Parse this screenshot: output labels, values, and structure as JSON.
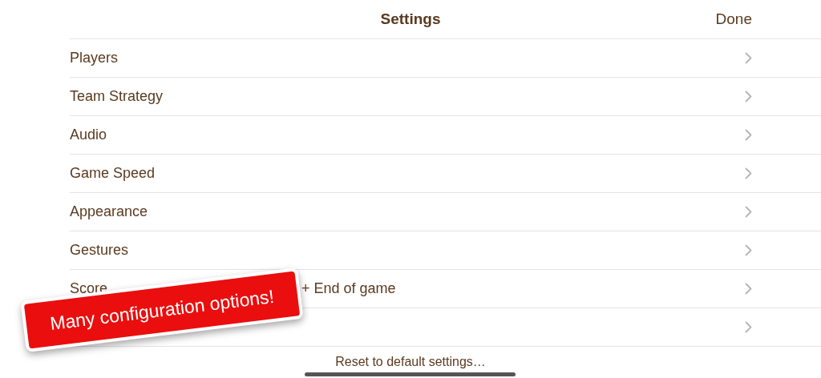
{
  "navigation_bar": {
    "title": "Settings",
    "done_button": "Done"
  },
  "settings_items": [
    {
      "parts": [
        "Players"
      ]
    },
    {
      "parts": [
        "Team Strategy"
      ]
    },
    {
      "parts": [
        "Audio"
      ]
    },
    {
      "parts": [
        "Game Speed"
      ]
    },
    {
      "parts": [
        "Appearance"
      ]
    },
    {
      "parts": [
        "Gestures"
      ]
    },
    {
      "parts": [
        "Score",
        "+ End of game"
      ]
    },
    {
      "kind": "covered"
    }
  ],
  "reset_button": "Reset to default settings…",
  "promo_banner": "Many configuration options!"
}
